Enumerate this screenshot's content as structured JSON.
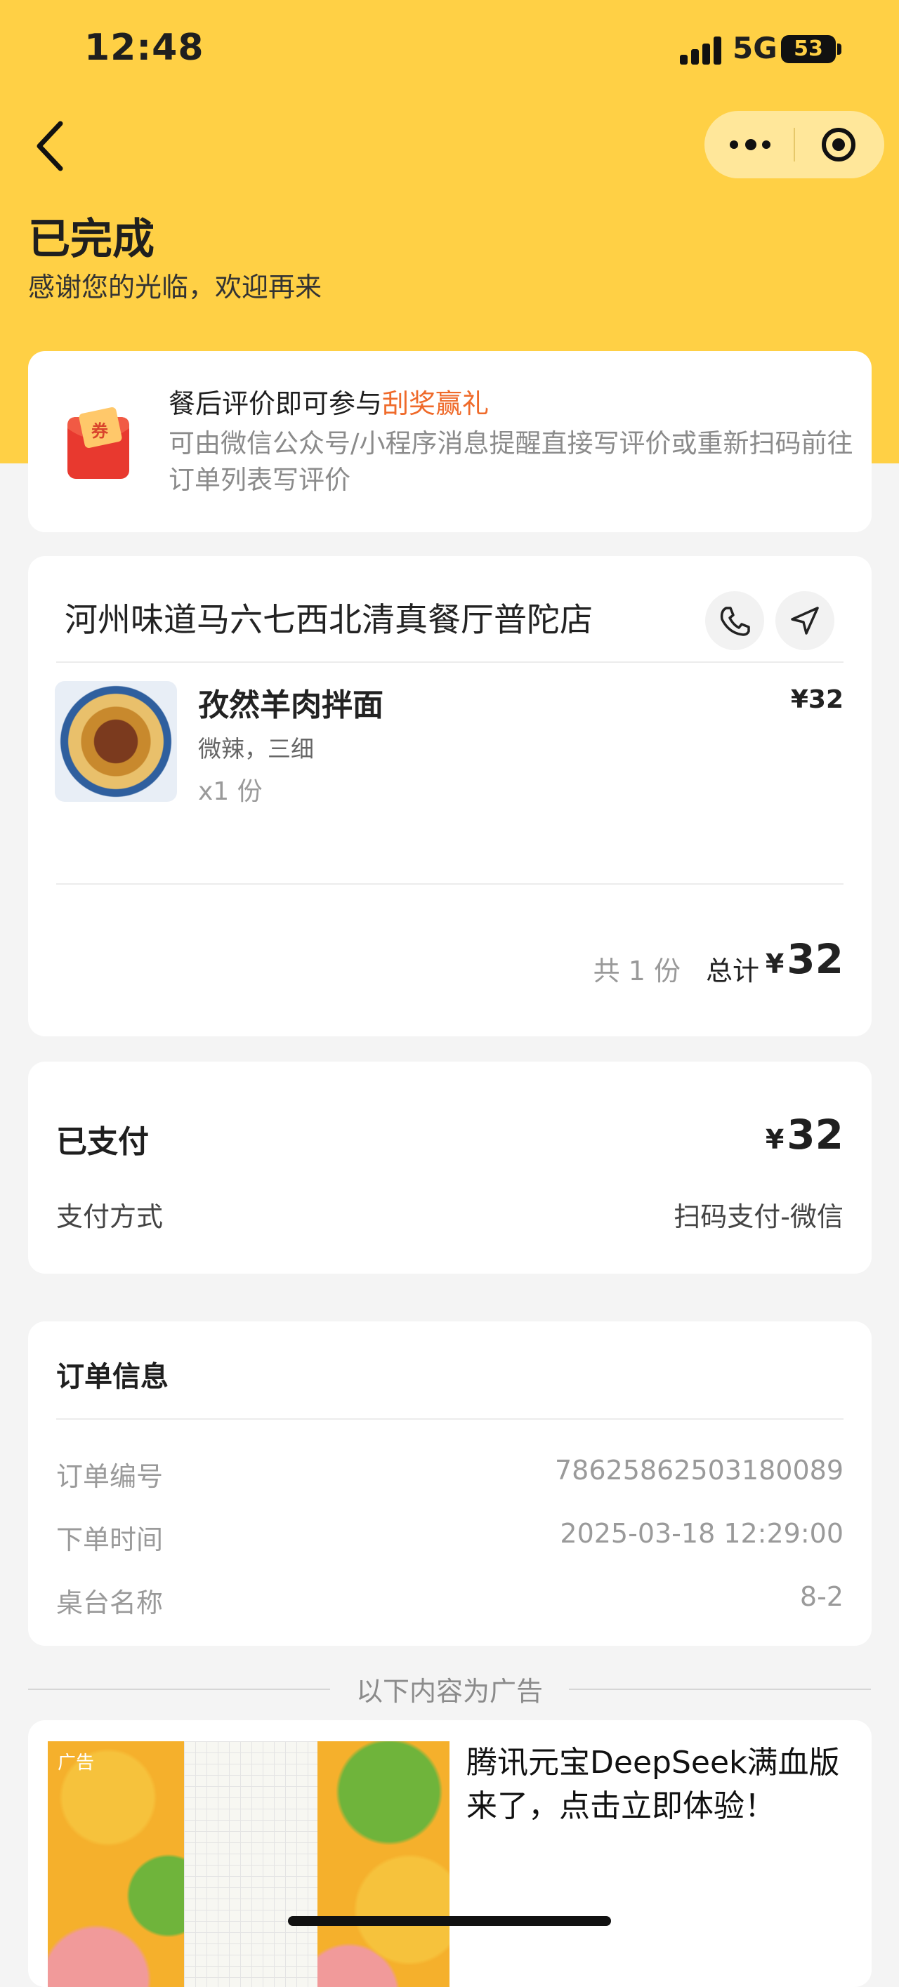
{
  "status_bar": {
    "time": "12:48",
    "network": "5G",
    "battery": "53"
  },
  "header": {
    "title": "已完成",
    "subtitle": "感谢您的光临，欢迎再来"
  },
  "promo": {
    "title_prefix": "餐后评价即可参与",
    "title_highlight": "刮奖赢礼",
    "description": "可由微信公众号/小程序消息提醒直接写评价或重新扫码前往订单列表写评价",
    "icon": "coupon-envelope-icon",
    "icon_text": "券",
    "highlight_color": "#ef6a2a"
  },
  "restaurant": {
    "name": "河州味道马六七西北清真餐厅普陀店",
    "items": [
      {
        "name": "孜然羊肉拌面",
        "spec": "微辣，三细",
        "qty": "x1 份",
        "price": "¥32"
      }
    ],
    "total_count": "共 1 份",
    "total_label": "总计",
    "total_currency": "¥",
    "total_amount": "32"
  },
  "payment": {
    "paid_label": "已支付",
    "paid_currency": "¥",
    "paid_amount": "32",
    "method_label": "支付方式",
    "method_value": "扫码支付-微信"
  },
  "order_info": {
    "title": "订单信息",
    "rows": [
      {
        "label": "订单编号",
        "value": "78625862503180089"
      },
      {
        "label": "下单时间",
        "value": "2025-03-18 12:29:00"
      },
      {
        "label": "桌台名称",
        "value": "8-2"
      }
    ]
  },
  "ad": {
    "divider_text": "以下内容为广告",
    "badge": "广告",
    "title": "腾讯元宝DeepSeek满血版来了，点击立即体验！",
    "brand": "腾讯元宝"
  },
  "colors": {
    "hero_bg": "#ffd045",
    "page_bg": "#f4f4f4"
  }
}
